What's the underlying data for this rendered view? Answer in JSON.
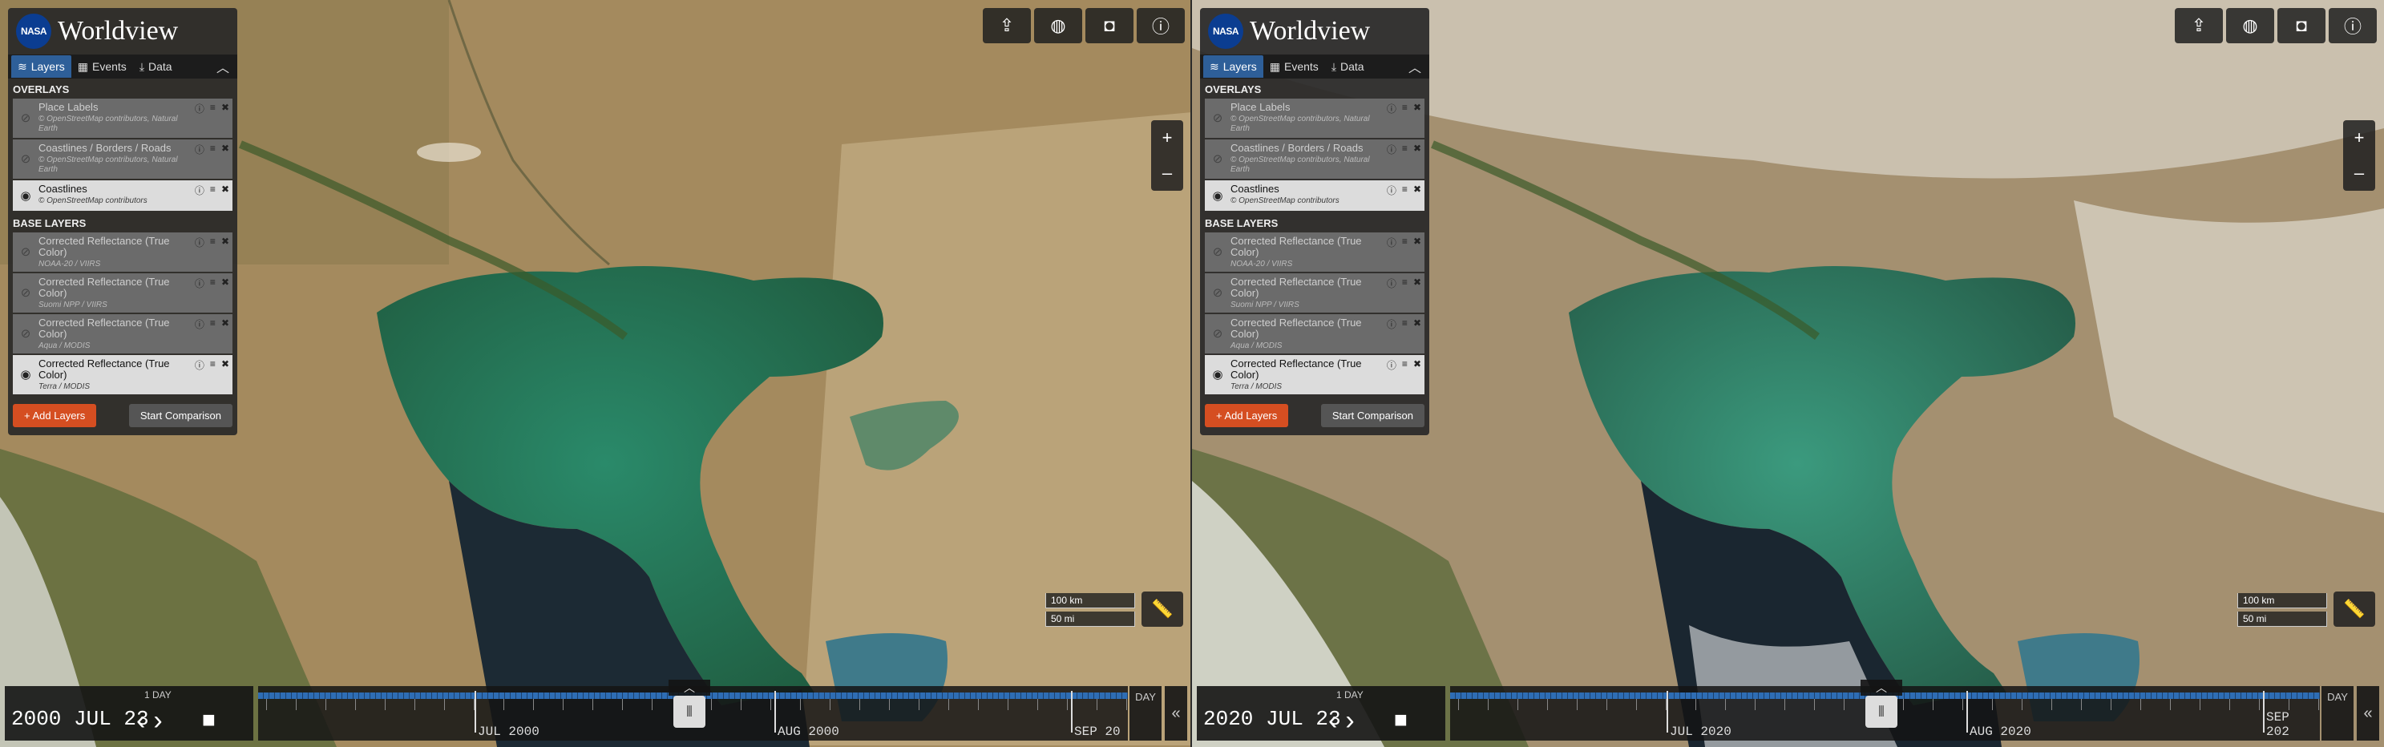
{
  "brand": {
    "logo_text": "NASA",
    "name": "Worldview"
  },
  "tabs": [
    {
      "label": "Layers",
      "icon": "layers-icon"
    },
    {
      "label": "Events",
      "icon": "calendar-icon"
    },
    {
      "label": "Data",
      "icon": "download-icon"
    }
  ],
  "sections": {
    "overlays": "OVERLAYS",
    "base_layers": "BASE LAYERS"
  },
  "overlays": [
    {
      "title": "Place Labels",
      "subtitle": "© OpenStreetMap contributors, Natural Earth",
      "visible": false
    },
    {
      "title": "Coastlines / Borders / Roads",
      "subtitle": "© OpenStreetMap contributors, Natural Earth",
      "visible": false
    },
    {
      "title": "Coastlines",
      "subtitle": "© OpenStreetMap contributors",
      "visible": true
    }
  ],
  "base_layers": [
    {
      "title": "Corrected Reflectance (True Color)",
      "subtitle": "NOAA-20 / VIIRS",
      "visible": false
    },
    {
      "title": "Corrected Reflectance (True Color)",
      "subtitle": "Suomi NPP / VIIRS",
      "visible": false
    },
    {
      "title": "Corrected Reflectance (True Color)",
      "subtitle": "Aqua / MODIS",
      "visible": false
    },
    {
      "title": "Corrected Reflectance (True Color)",
      "subtitle": "Terra / MODIS",
      "visible": true
    }
  ],
  "buttons": {
    "add_layers": "+ Add Layers",
    "start_comparison": "Start Comparison"
  },
  "toolbar": [
    "share-icon",
    "projection-icon",
    "camera-icon",
    "info-icon"
  ],
  "zoom": {
    "in": "+",
    "out": "–"
  },
  "scale": {
    "km": "100 km",
    "mi": "50 mi"
  },
  "timeline_left": {
    "date": "2000 JUL 23",
    "step": "1 DAY",
    "months": [
      "JUL 2000",
      "AUG 2000",
      "SEP 20"
    ],
    "zoom_level": "DAY"
  },
  "timeline_right": {
    "date": "2020 JUL 23",
    "step": "1 DAY",
    "months": [
      "JUL 2020",
      "AUG 2020",
      "SEP 202"
    ],
    "zoom_level": "DAY"
  },
  "colors": {
    "panel_bg": "#282828",
    "active_tab": "#2e5f99",
    "add_button": "#d54e21",
    "timeline_blue": "#2e6db4"
  }
}
